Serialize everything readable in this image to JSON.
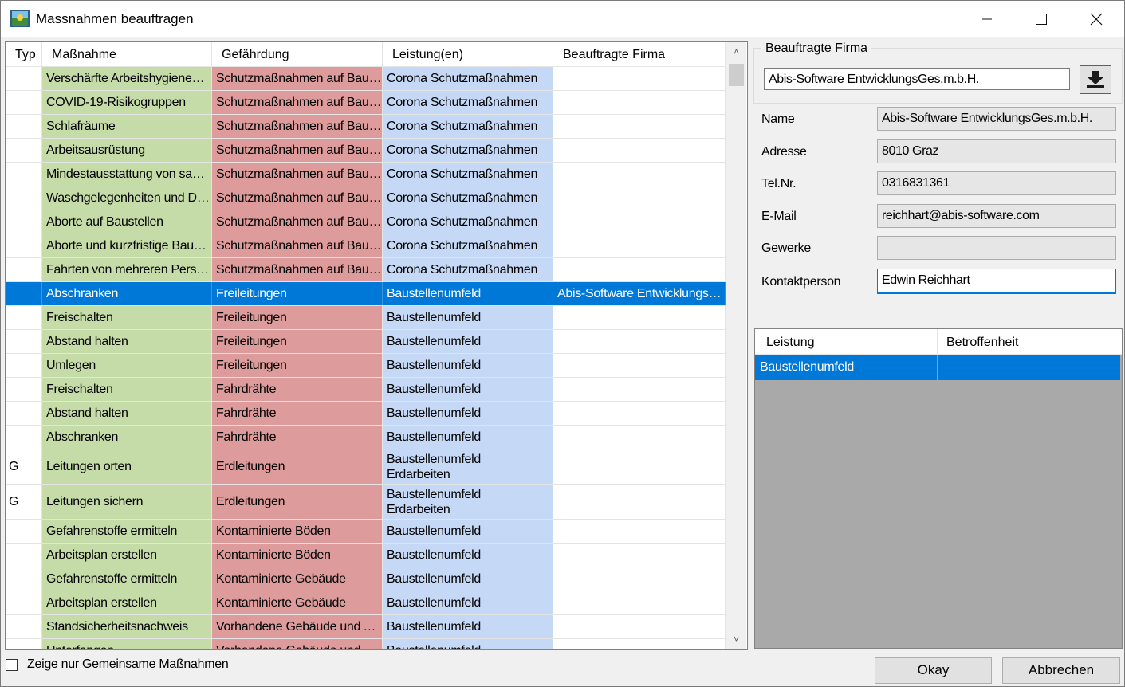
{
  "window": {
    "title": "Massnahmen beauftragen",
    "min_icon": "minimize-icon",
    "max_icon": "maximize-icon",
    "close_icon": "close-icon"
  },
  "grid": {
    "columns": [
      "Typ",
      "Maßnahme",
      "Gefährdung",
      "Leistung(en)",
      "Beauftragte Firma"
    ],
    "rows": [
      {
        "typ": "",
        "massnahme": "Verschärfte  Arbeitshygienemaßnahmen",
        "gefaehrdung": "Schutzmaßnahmen auf Baustellen",
        "leistung": "Corona Schutzmaßnahmen",
        "firma": "",
        "lines": 1
      },
      {
        "typ": "",
        "massnahme": "COVID-19-Risikogruppen",
        "gefaehrdung": "Schutzmaßnahmen auf Baustellen",
        "leistung": "Corona Schutzmaßnahmen",
        "firma": "",
        "lines": 1
      },
      {
        "typ": "",
        "massnahme": "Schlafräume",
        "gefaehrdung": "Schutzmaßnahmen auf Baustellen",
        "leistung": "Corona Schutzmaßnahmen",
        "firma": "",
        "lines": 1
      },
      {
        "typ": "",
        "massnahme": "Arbeitsausrüstung",
        "gefaehrdung": "Schutzmaßnahmen auf Baustellen",
        "leistung": "Corona Schutzmaßnahmen",
        "firma": "",
        "lines": 1
      },
      {
        "typ": "",
        "massnahme": "Mindestausstattung von sanitären Anlagen",
        "gefaehrdung": "Schutzmaßnahmen auf Baustellen",
        "leistung": "Corona Schutzmaßnahmen",
        "firma": "",
        "lines": 1
      },
      {
        "typ": "",
        "massnahme": "Waschgelegenheiten und Desinfektion",
        "gefaehrdung": "Schutzmaßnahmen auf Baustellen",
        "leistung": "Corona Schutzmaßnahmen",
        "firma": "",
        "lines": 1
      },
      {
        "typ": "",
        "massnahme": "Aborte auf Baustellen",
        "gefaehrdung": "Schutzmaßnahmen auf Baustellen",
        "leistung": "Corona Schutzmaßnahmen",
        "firma": "",
        "lines": 1
      },
      {
        "typ": "",
        "massnahme": " Aborte und kurzfristige Baustellen",
        "gefaehrdung": "Schutzmaßnahmen auf Baustellen",
        "leistung": "Corona Schutzmaßnahmen",
        "firma": "",
        "lines": 1
      },
      {
        "typ": "",
        "massnahme": "Fahrten von mehreren Personen",
        "gefaehrdung": "Schutzmaßnahmen auf Baustellen",
        "leistung": "Corona Schutzmaßnahmen",
        "firma": "",
        "lines": 1
      },
      {
        "typ": "",
        "massnahme": "Abschranken",
        "gefaehrdung": "Freileitungen",
        "leistung": "Baustellenumfeld",
        "firma": "Abis-Software EntwicklungsGes.m.b.H.",
        "lines": 1,
        "selected": true
      },
      {
        "typ": "",
        "massnahme": "Freischalten",
        "gefaehrdung": "Freileitungen",
        "leistung": "Baustellenumfeld",
        "firma": "",
        "lines": 1
      },
      {
        "typ": "",
        "massnahme": "Abstand halten",
        "gefaehrdung": "Freileitungen",
        "leistung": "Baustellenumfeld",
        "firma": "",
        "lines": 1
      },
      {
        "typ": "",
        "massnahme": "Umlegen",
        "gefaehrdung": "Freileitungen",
        "leistung": "Baustellenumfeld",
        "firma": "",
        "lines": 1
      },
      {
        "typ": "",
        "massnahme": "Freischalten",
        "gefaehrdung": "Fahrdrähte",
        "leistung": "Baustellenumfeld",
        "firma": "",
        "lines": 1
      },
      {
        "typ": "",
        "massnahme": "Abstand halten",
        "gefaehrdung": "Fahrdrähte",
        "leistung": "Baustellenumfeld",
        "firma": "",
        "lines": 1
      },
      {
        "typ": "",
        "massnahme": "Abschranken",
        "gefaehrdung": "Fahrdrähte",
        "leistung": "Baustellenumfeld",
        "firma": "",
        "lines": 1
      },
      {
        "typ": "G",
        "massnahme": "Leitungen orten",
        "gefaehrdung": "Erdleitungen",
        "leistung": "Baustellenumfeld\nErdarbeiten",
        "firma": "",
        "lines": 2
      },
      {
        "typ": "G",
        "massnahme": "Leitungen sichern",
        "gefaehrdung": "Erdleitungen",
        "leistung": "Baustellenumfeld\nErdarbeiten",
        "firma": "",
        "lines": 2
      },
      {
        "typ": "",
        "massnahme": "Gefahrenstoffe ermitteln",
        "gefaehrdung": "Kontaminierte Böden",
        "leistung": "Baustellenumfeld",
        "firma": "",
        "lines": 1
      },
      {
        "typ": "",
        "massnahme": "Arbeitsplan erstellen",
        "gefaehrdung": "Kontaminierte Böden",
        "leistung": "Baustellenumfeld",
        "firma": "",
        "lines": 1
      },
      {
        "typ": "",
        "massnahme": "Gefahrenstoffe ermitteln",
        "gefaehrdung": "Kontaminierte Gebäude",
        "leistung": "Baustellenumfeld",
        "firma": "",
        "lines": 1
      },
      {
        "typ": "",
        "massnahme": "Arbeitsplan erstellen",
        "gefaehrdung": "Kontaminierte Gebäude",
        "leistung": "Baustellenumfeld",
        "firma": "",
        "lines": 1
      },
      {
        "typ": "",
        "massnahme": "Standsicherheitsnachweis",
        "gefaehrdung": "Vorhandene Gebäude und Anlagen",
        "leistung": "Baustellenumfeld",
        "firma": "",
        "lines": 1
      },
      {
        "typ": "",
        "massnahme": "Unterfangen",
        "gefaehrdung": "Vorhandene Gebäude und Anlagen",
        "leistung": "Baustellenumfeld",
        "firma": "",
        "lines": 1
      }
    ]
  },
  "firma_group": {
    "label": "Beauftragte Firma",
    "selected_value": "Abis-Software EntwicklungsGes.m.b.H.",
    "button_icon": "download-icon"
  },
  "details": {
    "name_label": "Name",
    "name_value": "Abis-Software EntwicklungsGes.m.b.H.",
    "adresse_label": "Adresse",
    "adresse_value": "8010 Graz",
    "tel_label": "Tel.Nr.",
    "tel_value": "0316831361",
    "email_label": "E-Mail",
    "email_value": "reichhart@abis-software.com",
    "gewerke_label": "Gewerke",
    "gewerke_value": "",
    "kontakt_label": "Kontaktperson",
    "kontakt_value": "Edwin Reichhart"
  },
  "leistung_grid": {
    "columns": [
      "Leistung",
      "Betroffenheit"
    ],
    "rows": [
      {
        "leistung": "Baustellenumfeld",
        "betroffenheit": ""
      }
    ]
  },
  "footer": {
    "checkbox_label": "Zeige nur Gemeinsame Maßnahmen",
    "checkbox_checked": false,
    "ok_label": "Okay",
    "cancel_label": "Abbrechen"
  },
  "colors": {
    "massnahme_bg": "#c6dca8",
    "gefaehrdung_bg": "#dd9b9b",
    "leistung_bg": "#c5d8f5",
    "selection": "#0078d7"
  }
}
